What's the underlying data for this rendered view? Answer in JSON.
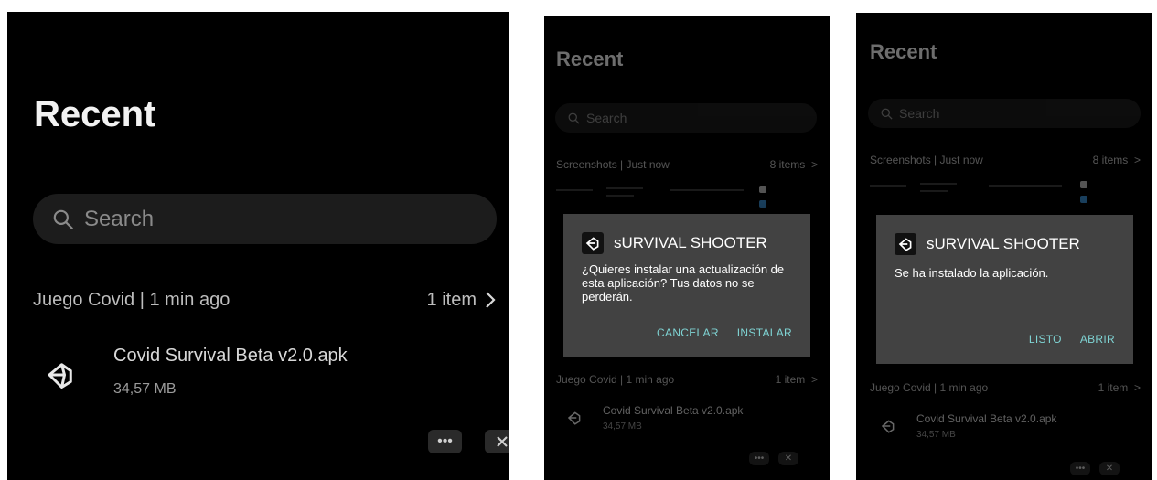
{
  "panel_large": {
    "title": "Recent",
    "search_placeholder": "Search",
    "section": {
      "title": "Juego Covid | 1 min ago",
      "count": "1 item"
    },
    "file": {
      "name": "Covid Survival Beta v2.0.apk",
      "size": "34,57 MB",
      "icon": "unity-icon"
    },
    "actions": {
      "more": "more-icon",
      "close": "close-icon"
    }
  },
  "panel_install": {
    "title": "Recent",
    "search_placeholder": "Search",
    "section_screenshots": {
      "title": "Screenshots | Just now",
      "count": "8 items"
    },
    "section_juego": {
      "title": "Juego Covid | 1 min ago",
      "count": "1 item"
    },
    "file": {
      "name": "Covid Survival Beta v2.0.apk",
      "size": "34,57 MB"
    },
    "dialog": {
      "title": "sURVIVAL SHOOTER",
      "message": "¿Quieres instalar una actualización de esta aplicación? Tus datos no se perderán.",
      "cancel_label": "CANCELAR",
      "confirm_label": "INSTALAR"
    }
  },
  "panel_installed": {
    "title": "Recent",
    "search_placeholder": "Search",
    "section_screenshots": {
      "title": "Screenshots | Just now",
      "count": "8 items"
    },
    "section_juego": {
      "title": "Juego Covid | 1 min ago",
      "count": "1 item"
    },
    "file": {
      "name": "Covid Survival Beta v2.0.apk",
      "size": "34,57 MB"
    },
    "dialog": {
      "title": "sURVIVAL SHOOTER",
      "message": "Se ha instalado la aplicación.",
      "done_label": "LISTO",
      "open_label": "ABRIR"
    }
  },
  "colors": {
    "background": "#000000",
    "search_bg": "#1c1c1c",
    "dialog_bg": "#424242",
    "dialog_button": "#7fd4d4"
  }
}
